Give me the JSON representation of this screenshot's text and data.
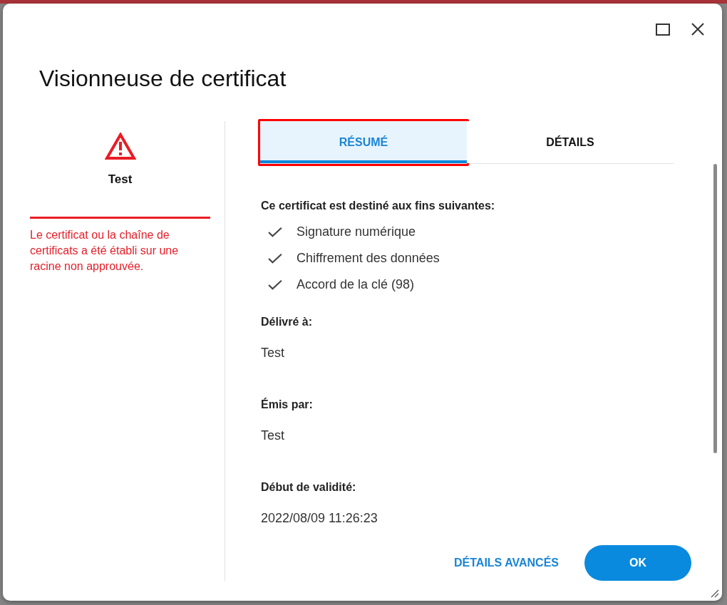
{
  "window": {
    "title": "Visionneuse de certificat"
  },
  "summary_panel": {
    "trusted": false,
    "subject": "Test",
    "message": "Le certificat ou la chaîne de certificats a été établi sur une racine non approuvée."
  },
  "tabs": [
    {
      "label": "RÉSUMÉ",
      "selected": true,
      "highlighted": true
    },
    {
      "label": "DÉTAILS",
      "selected": false,
      "highlighted": false
    }
  ],
  "summary": {
    "purposes_heading": "Ce certificat est destiné aux fins suivantes:",
    "purposes": [
      {
        "label": "Signature numérique",
        "checked": true
      },
      {
        "label": "Chiffrement des données",
        "checked": true
      },
      {
        "label": "Accord de la clé (98)",
        "checked": true
      }
    ],
    "fields": [
      {
        "label": "Délivré à:",
        "value": "Test"
      },
      {
        "label": "Émis par:",
        "value": "Test"
      },
      {
        "label": "Début de validité:",
        "value": "2022/08/09 11:26:23"
      }
    ]
  },
  "buttons": [
    {
      "label": "DÉTAILS AVANCÉS",
      "kind": "text"
    },
    {
      "label": "OK",
      "kind": "filled"
    }
  ]
}
